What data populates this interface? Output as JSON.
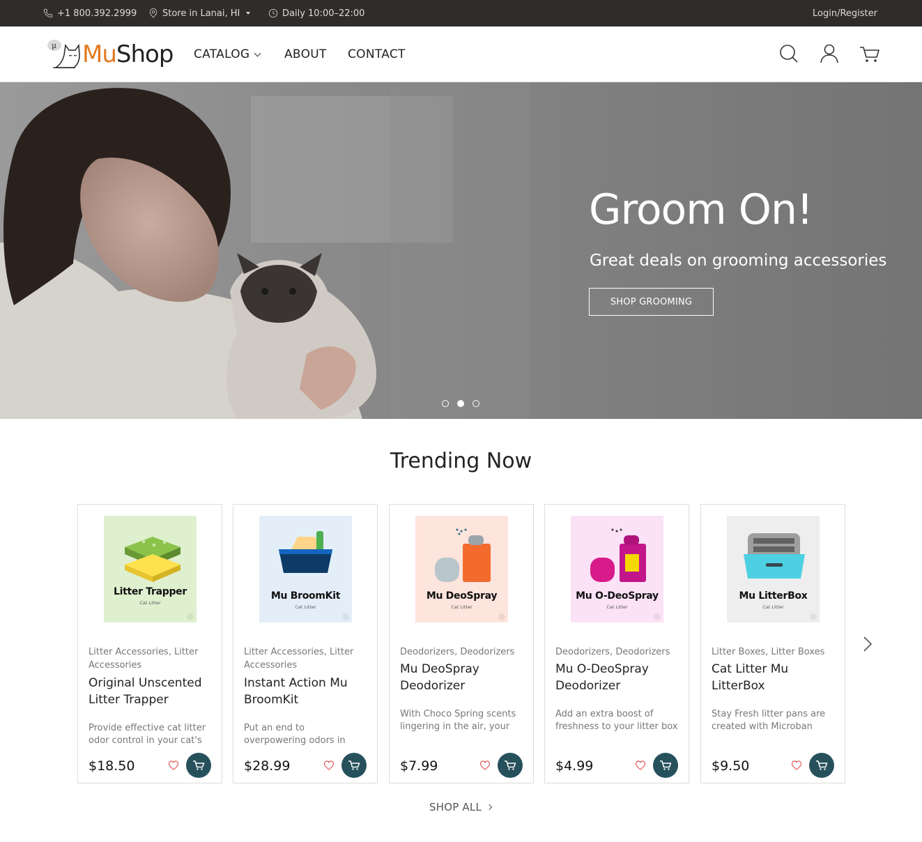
{
  "topbar": {
    "phone": "+1 800.392.2999",
    "store": "Store in Lanai, HI",
    "hours": "Daily 10:00–22:00",
    "login": "Login/Register"
  },
  "header": {
    "logo_badge": "μ",
    "logo_mu": "Mu",
    "logo_shop": "Shop",
    "nav": {
      "catalog": "CATALOG",
      "about": "ABOUT",
      "contact": "CONTACT"
    },
    "icons": [
      "search-icon",
      "user-icon",
      "cart-icon"
    ]
  },
  "hero": {
    "title": "Groom On!",
    "subtitle": "Great deals on grooming accessories",
    "button": "SHOP GROOMING",
    "slides": 3,
    "active_slide": 2
  },
  "trending": {
    "title": "Trending Now",
    "products": [
      {
        "image_label": "Litter Trapper",
        "image_sublabel": "Cat Litter",
        "image_bg": "#dff0cf",
        "categories": "Litter Accessories, Litter Accessories",
        "name": "Original Unscented Litter Trapper",
        "description": "Provide effective cat litter odor control in your cat's",
        "price": "$18.50"
      },
      {
        "image_label": "Mu BroomKit",
        "image_sublabel": "Cat Litter",
        "image_bg": "#e3eef9",
        "categories": "Litter Accessories, Litter Accessories",
        "name": "Instant Action Mu BroomKit",
        "description": "Put an end to overpowering odors in",
        "price": "$28.99"
      },
      {
        "image_label": "Mu DeoSpray",
        "image_sublabel": "Cat Litter",
        "image_bg": "#fde4dc",
        "categories": "Deodorizers, Deodorizers",
        "name": "Mu DeoSpray Deodorizer",
        "description": "With Choco Spring scents lingering in the air, your",
        "price": "$7.99"
      },
      {
        "image_label": "Mu O-DeoSpray",
        "image_sublabel": "Cat Litter",
        "image_bg": "#fbe2f6",
        "categories": "Deodorizers, Deodorizers",
        "name": "Mu O-DeoSpray Deodorizer",
        "description": "Add an extra boost of freshness to your litter box",
        "price": "$4.99"
      },
      {
        "image_label": "Mu LitterBox",
        "image_sublabel": "Cat Litter",
        "image_bg": "#eeeeee",
        "categories": "Litter Boxes, Litter Boxes",
        "name": "Cat Litter Mu LitterBox",
        "description": "Stay Fresh litter pans are created with Microban",
        "price": "$9.50"
      }
    ],
    "shop_all": "SHOP ALL"
  },
  "colors": {
    "topbar": "#2f2c2a",
    "brand_orange": "#e07a1f",
    "cart_button": "#26505c",
    "heart": "#e05a5a"
  }
}
